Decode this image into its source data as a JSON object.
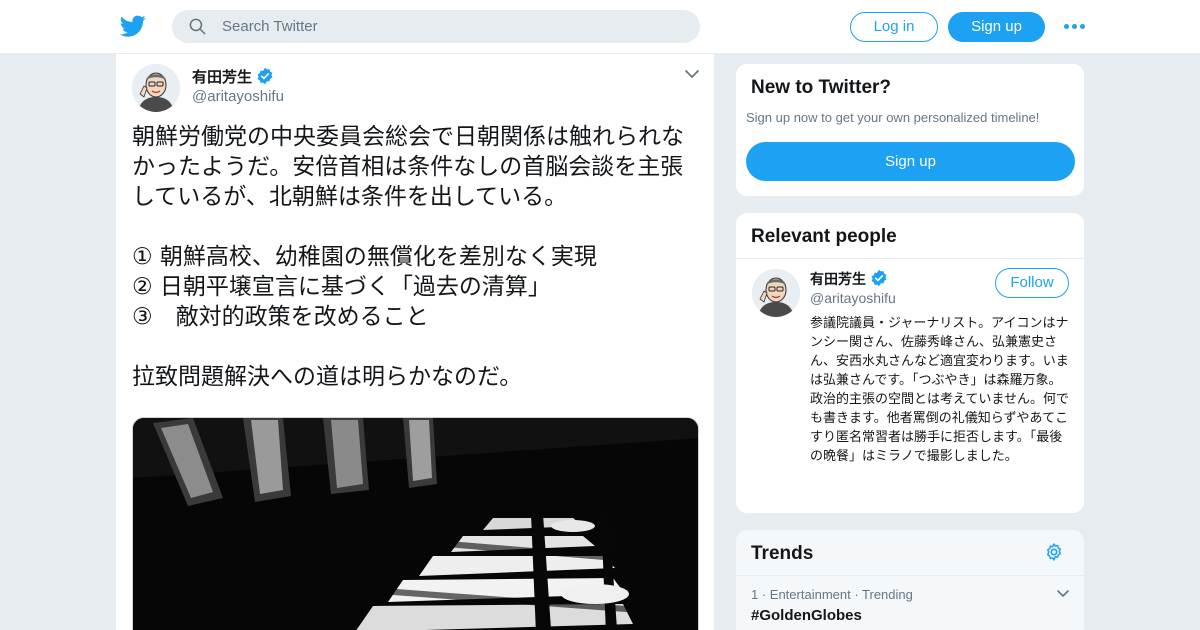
{
  "header": {
    "search_placeholder": "Search Twitter",
    "login_label": "Log in",
    "signup_label": "Sign up",
    "brand_color": "#1da1f2",
    "icons": [
      "twitter-logo-icon",
      "search-icon",
      "more-icon"
    ]
  },
  "tweet": {
    "author_name": "有田芳生",
    "author_handle": "@aritayoshifu",
    "verified": true,
    "text": "朝鮮労働党の中央委員会総会で日朝関係は触れられなかったようだ。安倍首相は条件なしの首脳会談を主張しているが、北朝鮮は条件を出している。\n\n① 朝鮮高校、幼稚園の無償化を差別なく実現\n② 日朝平壌宣言に基づく「過去の清算」\n③　敵対的政策を改めること\n\n拉致問題解決への道は明らかなのだ。",
    "has_image": true
  },
  "new_to_twitter": {
    "title": "New to Twitter?",
    "subtitle": "Sign up now to get your own personalized timeline!",
    "button_label": "Sign up"
  },
  "relevant_people": {
    "title": "Relevant people",
    "person": {
      "name": "有田芳生",
      "handle": "@aritayoshifu",
      "verified": true,
      "follow_label": "Follow",
      "bio": "参議院議員・ジャーナリスト。アイコンはナンシー関さん、佐藤秀峰さん、弘兼憲史さん、安西水丸さんなど適宜変わります。いまは弘兼さんです。「つぶやき」は森羅万象。政治的主張の空間とは考えていません。何でも書きます。他者罵倒の礼儀知らずやあてこすり匿名常習者は勝手に拒否します。「最後の晩餐」はミラノで撮影しました。"
    }
  },
  "trends": {
    "title": "Trends",
    "items": [
      {
        "meta": "1 · Entertainment · Trending",
        "name": "#GoldenGlobes"
      }
    ]
  }
}
